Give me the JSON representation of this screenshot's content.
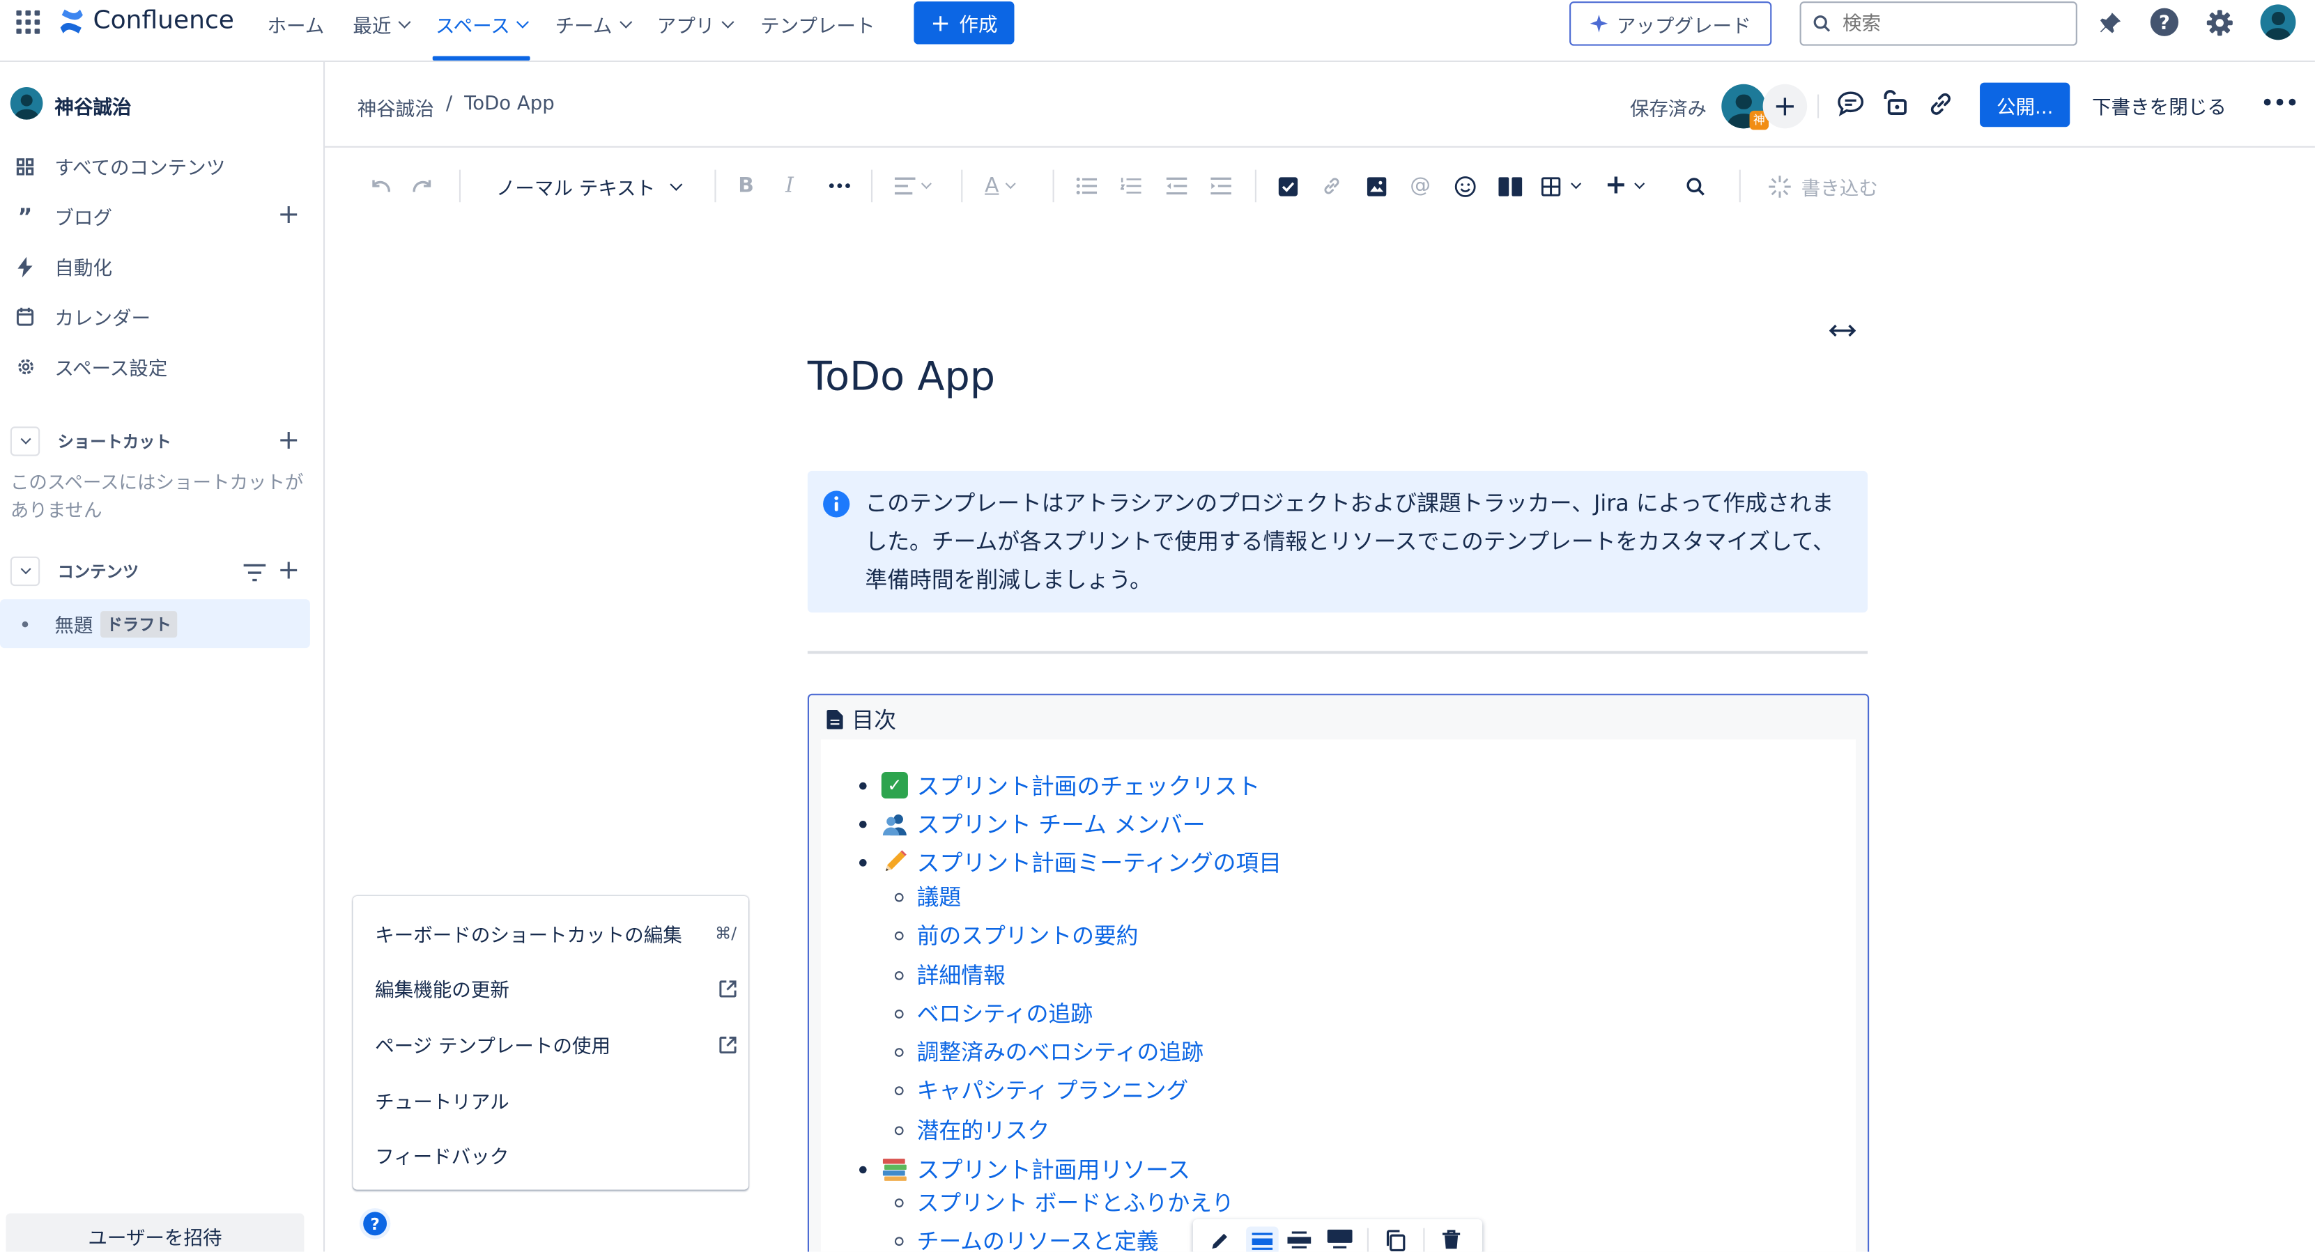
{
  "app": {
    "name": "Confluence"
  },
  "topnav": {
    "items": [
      "ホーム",
      "最近",
      "スペース",
      "チーム",
      "アプリ",
      "テンプレート"
    ],
    "create_label": "作成",
    "upgrade_label": "アップグレード",
    "search_placeholder": "検索"
  },
  "sidebar": {
    "user_name": "神谷誠治",
    "items": [
      "すべてのコンテンツ",
      "ブログ",
      "自動化",
      "カレンダー",
      "スペース設定"
    ],
    "shortcuts_title": "ショートカット",
    "shortcuts_empty": "このスペースにはショートカットがありません",
    "contents_title": "コンテンツ",
    "page_item": "無題",
    "page_badge": "ドラフト",
    "invite_label": "ユーザーを招待"
  },
  "header": {
    "breadcrumb_space": "神谷誠治",
    "breadcrumb_sep": "/",
    "breadcrumb_page": "ToDo App",
    "saved_label": "保存済み",
    "avatar_badge": "神",
    "publish_label": "公開...",
    "close_draft_label": "下書きを閉じる"
  },
  "toolbar": {
    "text_style": "ノーマル テキスト",
    "write_label": "書き込む"
  },
  "page": {
    "title": "ToDo App",
    "info_text": "このテンプレートはアトラシアンのプロジェクトおよび課題トラッカー、Jira によって作成されました。チームが各スプリントで使用する情報とリソースでこのテンプレートをカスタマイズして、準備時間を削減しましょう。"
  },
  "toc": {
    "title": "目次",
    "items": [
      {
        "emoji": "✅",
        "label": "スプリント計画のチェックリスト"
      },
      {
        "emoji": "👥",
        "label": "スプリント チーム メンバー"
      },
      {
        "emoji": "✏️",
        "label": "スプリント計画ミーティングの項目"
      },
      {
        "label": "議題"
      },
      {
        "label": "前のスプリントの要約"
      },
      {
        "label": "詳細情報"
      },
      {
        "label": "ベロシティの追跡"
      },
      {
        "label": "調整済みのベロシティの追跡"
      },
      {
        "label": "キャパシティ プランニング"
      },
      {
        "label": "潜在的リスク"
      },
      {
        "emoji": "📚",
        "label": "スプリント計画用リソース"
      },
      {
        "label": "スプリント ボードとふりかえり"
      },
      {
        "label": "チームのリソースと定義"
      }
    ]
  },
  "help_menu": {
    "items": [
      {
        "label": "キーボードのショートカットの編集",
        "shortcut": "⌘/"
      },
      {
        "label": "編集機能の更新",
        "icon": "external-link-icon"
      },
      {
        "label": "ページ テンプレートの使用",
        "icon": "external-link-icon"
      },
      {
        "label": "チュートリアル"
      },
      {
        "label": "フィードバック"
      }
    ]
  },
  "colors": {
    "brand_blue": "#0c66e4",
    "info_bg": "#e9f2ff",
    "text": "#172b4d"
  }
}
